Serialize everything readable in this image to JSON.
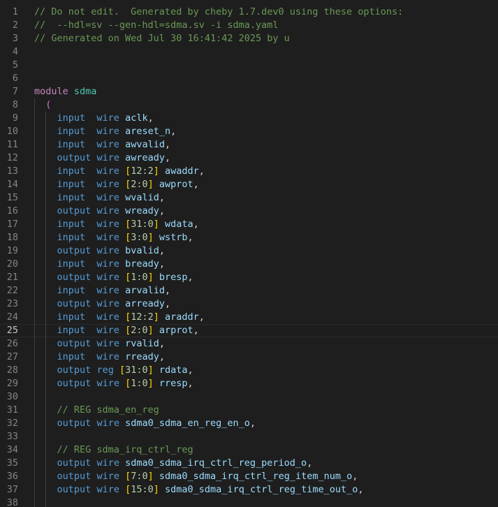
{
  "editor": {
    "lines": [
      {
        "n": "1",
        "tokens": [
          [
            "comment",
            "// Do not edit.  Generated by cheby 1.7.dev0 using these options:"
          ]
        ]
      },
      {
        "n": "2",
        "tokens": [
          [
            "comment",
            "//  --hdl=sv --gen-hdl=sdma.sv -i sdma.yaml"
          ]
        ]
      },
      {
        "n": "3",
        "tokens": [
          [
            "comment",
            "// Generated on Wed Jul 30 16:41:42 2025 by u"
          ]
        ]
      },
      {
        "n": "4",
        "tokens": []
      },
      {
        "n": "5",
        "tokens": []
      },
      {
        "n": "6",
        "tokens": []
      },
      {
        "n": "7",
        "tokens": [
          [
            "module",
            "module"
          ],
          [
            "punct",
            " "
          ],
          [
            "modname",
            "sdma"
          ]
        ]
      },
      {
        "n": "8",
        "tokens": [
          [
            "ws",
            "  "
          ],
          [
            "paren",
            "("
          ]
        ]
      },
      {
        "n": "9",
        "tokens": [
          [
            "ws",
            "    "
          ],
          [
            "keyword",
            "input"
          ],
          [
            "punct",
            "  "
          ],
          [
            "type",
            "wire"
          ],
          [
            "punct",
            " "
          ],
          [
            "ident",
            "aclk"
          ],
          [
            "punct",
            ","
          ]
        ]
      },
      {
        "n": "10",
        "tokens": [
          [
            "ws",
            "    "
          ],
          [
            "keyword",
            "input"
          ],
          [
            "punct",
            "  "
          ],
          [
            "type",
            "wire"
          ],
          [
            "punct",
            " "
          ],
          [
            "ident",
            "areset_n"
          ],
          [
            "punct",
            ","
          ]
        ]
      },
      {
        "n": "11",
        "tokens": [
          [
            "ws",
            "    "
          ],
          [
            "keyword",
            "input"
          ],
          [
            "punct",
            "  "
          ],
          [
            "type",
            "wire"
          ],
          [
            "punct",
            " "
          ],
          [
            "ident",
            "awvalid"
          ],
          [
            "punct",
            ","
          ]
        ]
      },
      {
        "n": "12",
        "tokens": [
          [
            "ws",
            "    "
          ],
          [
            "keyword",
            "output"
          ],
          [
            "punct",
            " "
          ],
          [
            "type",
            "wire"
          ],
          [
            "punct",
            " "
          ],
          [
            "ident",
            "awready"
          ],
          [
            "punct",
            ","
          ]
        ]
      },
      {
        "n": "13",
        "tokens": [
          [
            "ws",
            "    "
          ],
          [
            "keyword",
            "input"
          ],
          [
            "punct",
            "  "
          ],
          [
            "type",
            "wire"
          ],
          [
            "punct",
            " "
          ],
          [
            "bracket",
            "["
          ],
          [
            "range",
            "12:2"
          ],
          [
            "bracket",
            "]"
          ],
          [
            "punct",
            " "
          ],
          [
            "ident",
            "awaddr"
          ],
          [
            "punct",
            ","
          ]
        ]
      },
      {
        "n": "14",
        "tokens": [
          [
            "ws",
            "    "
          ],
          [
            "keyword",
            "input"
          ],
          [
            "punct",
            "  "
          ],
          [
            "type",
            "wire"
          ],
          [
            "punct",
            " "
          ],
          [
            "bracket",
            "["
          ],
          [
            "range",
            "2:0"
          ],
          [
            "bracket",
            "]"
          ],
          [
            "punct",
            " "
          ],
          [
            "ident",
            "awprot"
          ],
          [
            "punct",
            ","
          ]
        ]
      },
      {
        "n": "15",
        "tokens": [
          [
            "ws",
            "    "
          ],
          [
            "keyword",
            "input"
          ],
          [
            "punct",
            "  "
          ],
          [
            "type",
            "wire"
          ],
          [
            "punct",
            " "
          ],
          [
            "ident",
            "wvalid"
          ],
          [
            "punct",
            ","
          ]
        ]
      },
      {
        "n": "16",
        "tokens": [
          [
            "ws",
            "    "
          ],
          [
            "keyword",
            "output"
          ],
          [
            "punct",
            " "
          ],
          [
            "type",
            "wire"
          ],
          [
            "punct",
            " "
          ],
          [
            "ident",
            "wready"
          ],
          [
            "punct",
            ","
          ]
        ]
      },
      {
        "n": "17",
        "tokens": [
          [
            "ws",
            "    "
          ],
          [
            "keyword",
            "input"
          ],
          [
            "punct",
            "  "
          ],
          [
            "type",
            "wire"
          ],
          [
            "punct",
            " "
          ],
          [
            "bracket",
            "["
          ],
          [
            "range",
            "31:0"
          ],
          [
            "bracket",
            "]"
          ],
          [
            "punct",
            " "
          ],
          [
            "ident",
            "wdata"
          ],
          [
            "punct",
            ","
          ]
        ]
      },
      {
        "n": "18",
        "tokens": [
          [
            "ws",
            "    "
          ],
          [
            "keyword",
            "input"
          ],
          [
            "punct",
            "  "
          ],
          [
            "type",
            "wire"
          ],
          [
            "punct",
            " "
          ],
          [
            "bracket",
            "["
          ],
          [
            "range",
            "3:0"
          ],
          [
            "bracket",
            "]"
          ],
          [
            "punct",
            " "
          ],
          [
            "ident",
            "wstrb"
          ],
          [
            "punct",
            ","
          ]
        ]
      },
      {
        "n": "19",
        "tokens": [
          [
            "ws",
            "    "
          ],
          [
            "keyword",
            "output"
          ],
          [
            "punct",
            " "
          ],
          [
            "type",
            "wire"
          ],
          [
            "punct",
            " "
          ],
          [
            "ident",
            "bvalid"
          ],
          [
            "punct",
            ","
          ]
        ]
      },
      {
        "n": "20",
        "tokens": [
          [
            "ws",
            "    "
          ],
          [
            "keyword",
            "input"
          ],
          [
            "punct",
            "  "
          ],
          [
            "type",
            "wire"
          ],
          [
            "punct",
            " "
          ],
          [
            "ident",
            "bready"
          ],
          [
            "punct",
            ","
          ]
        ]
      },
      {
        "n": "21",
        "tokens": [
          [
            "ws",
            "    "
          ],
          [
            "keyword",
            "output"
          ],
          [
            "punct",
            " "
          ],
          [
            "type",
            "wire"
          ],
          [
            "punct",
            " "
          ],
          [
            "bracket",
            "["
          ],
          [
            "range",
            "1:0"
          ],
          [
            "bracket",
            "]"
          ],
          [
            "punct",
            " "
          ],
          [
            "ident",
            "bresp"
          ],
          [
            "punct",
            ","
          ]
        ]
      },
      {
        "n": "22",
        "tokens": [
          [
            "ws",
            "    "
          ],
          [
            "keyword",
            "input"
          ],
          [
            "punct",
            "  "
          ],
          [
            "type",
            "wire"
          ],
          [
            "punct",
            " "
          ],
          [
            "ident",
            "arvalid"
          ],
          [
            "punct",
            ","
          ]
        ]
      },
      {
        "n": "23",
        "tokens": [
          [
            "ws",
            "    "
          ],
          [
            "keyword",
            "output"
          ],
          [
            "punct",
            " "
          ],
          [
            "type",
            "wire"
          ],
          [
            "punct",
            " "
          ],
          [
            "ident",
            "arready"
          ],
          [
            "punct",
            ","
          ]
        ]
      },
      {
        "n": "24",
        "tokens": [
          [
            "ws",
            "    "
          ],
          [
            "keyword",
            "input"
          ],
          [
            "punct",
            "  "
          ],
          [
            "type",
            "wire"
          ],
          [
            "punct",
            " "
          ],
          [
            "bracket",
            "["
          ],
          [
            "range",
            "12:2"
          ],
          [
            "bracket",
            "]"
          ],
          [
            "punct",
            " "
          ],
          [
            "ident",
            "araddr"
          ],
          [
            "punct",
            ","
          ]
        ]
      },
      {
        "n": "25",
        "current": true,
        "tokens": [
          [
            "ws",
            "    "
          ],
          [
            "keyword",
            "input"
          ],
          [
            "punct",
            "  "
          ],
          [
            "type",
            "wire"
          ],
          [
            "punct",
            " "
          ],
          [
            "bracket",
            "["
          ],
          [
            "range",
            "2:0"
          ],
          [
            "bracket",
            "]"
          ],
          [
            "punct",
            " "
          ],
          [
            "ident",
            "arprot"
          ],
          [
            "punct",
            ","
          ]
        ]
      },
      {
        "n": "26",
        "tokens": [
          [
            "ws",
            "    "
          ],
          [
            "keyword",
            "output"
          ],
          [
            "punct",
            " "
          ],
          [
            "type",
            "wire"
          ],
          [
            "punct",
            " "
          ],
          [
            "ident",
            "rvalid"
          ],
          [
            "punct",
            ","
          ]
        ]
      },
      {
        "n": "27",
        "tokens": [
          [
            "ws",
            "    "
          ],
          [
            "keyword",
            "input"
          ],
          [
            "punct",
            "  "
          ],
          [
            "type",
            "wire"
          ],
          [
            "punct",
            " "
          ],
          [
            "ident",
            "rready"
          ],
          [
            "punct",
            ","
          ]
        ]
      },
      {
        "n": "28",
        "tokens": [
          [
            "ws",
            "    "
          ],
          [
            "keyword",
            "output"
          ],
          [
            "punct",
            " "
          ],
          [
            "type",
            "reg"
          ],
          [
            "punct",
            " "
          ],
          [
            "bracket",
            "["
          ],
          [
            "range",
            "31:0"
          ],
          [
            "bracket",
            "]"
          ],
          [
            "punct",
            " "
          ],
          [
            "ident",
            "rdata"
          ],
          [
            "punct",
            ","
          ]
        ]
      },
      {
        "n": "29",
        "tokens": [
          [
            "ws",
            "    "
          ],
          [
            "keyword",
            "output"
          ],
          [
            "punct",
            " "
          ],
          [
            "type",
            "wire"
          ],
          [
            "punct",
            " "
          ],
          [
            "bracket",
            "["
          ],
          [
            "range",
            "1:0"
          ],
          [
            "bracket",
            "]"
          ],
          [
            "punct",
            " "
          ],
          [
            "ident",
            "rresp"
          ],
          [
            "punct",
            ","
          ]
        ]
      },
      {
        "n": "30",
        "tokens": []
      },
      {
        "n": "31",
        "tokens": [
          [
            "ws",
            "    "
          ],
          [
            "comment",
            "// REG sdma_en_reg"
          ]
        ]
      },
      {
        "n": "32",
        "tokens": [
          [
            "ws",
            "    "
          ],
          [
            "keyword",
            "output"
          ],
          [
            "punct",
            " "
          ],
          [
            "type",
            "wire"
          ],
          [
            "punct",
            " "
          ],
          [
            "ident",
            "sdma0_sdma_en_reg_en_o"
          ],
          [
            "punct",
            ","
          ]
        ]
      },
      {
        "n": "33",
        "tokens": []
      },
      {
        "n": "34",
        "tokens": [
          [
            "ws",
            "    "
          ],
          [
            "comment",
            "// REG sdma_irq_ctrl_reg"
          ]
        ]
      },
      {
        "n": "35",
        "tokens": [
          [
            "ws",
            "    "
          ],
          [
            "keyword",
            "output"
          ],
          [
            "punct",
            " "
          ],
          [
            "type",
            "wire"
          ],
          [
            "punct",
            " "
          ],
          [
            "ident",
            "sdma0_sdma_irq_ctrl_reg_period_o"
          ],
          [
            "punct",
            ","
          ]
        ]
      },
      {
        "n": "36",
        "tokens": [
          [
            "ws",
            "    "
          ],
          [
            "keyword",
            "output"
          ],
          [
            "punct",
            " "
          ],
          [
            "type",
            "wire"
          ],
          [
            "punct",
            " "
          ],
          [
            "bracket",
            "["
          ],
          [
            "range",
            "7:0"
          ],
          [
            "bracket",
            "]"
          ],
          [
            "punct",
            " "
          ],
          [
            "ident",
            "sdma0_sdma_irq_ctrl_reg_item_num_o"
          ],
          [
            "punct",
            ","
          ]
        ]
      },
      {
        "n": "37",
        "tokens": [
          [
            "ws",
            "    "
          ],
          [
            "keyword",
            "output"
          ],
          [
            "punct",
            " "
          ],
          [
            "type",
            "wire"
          ],
          [
            "punct",
            " "
          ],
          [
            "bracket",
            "["
          ],
          [
            "range",
            "15:0"
          ],
          [
            "bracket",
            "]"
          ],
          [
            "punct",
            " "
          ],
          [
            "ident",
            "sdma0_sdma_irq_ctrl_reg_time_out_o"
          ],
          [
            "punct",
            ","
          ]
        ]
      },
      {
        "n": "38",
        "tokens": []
      }
    ]
  }
}
